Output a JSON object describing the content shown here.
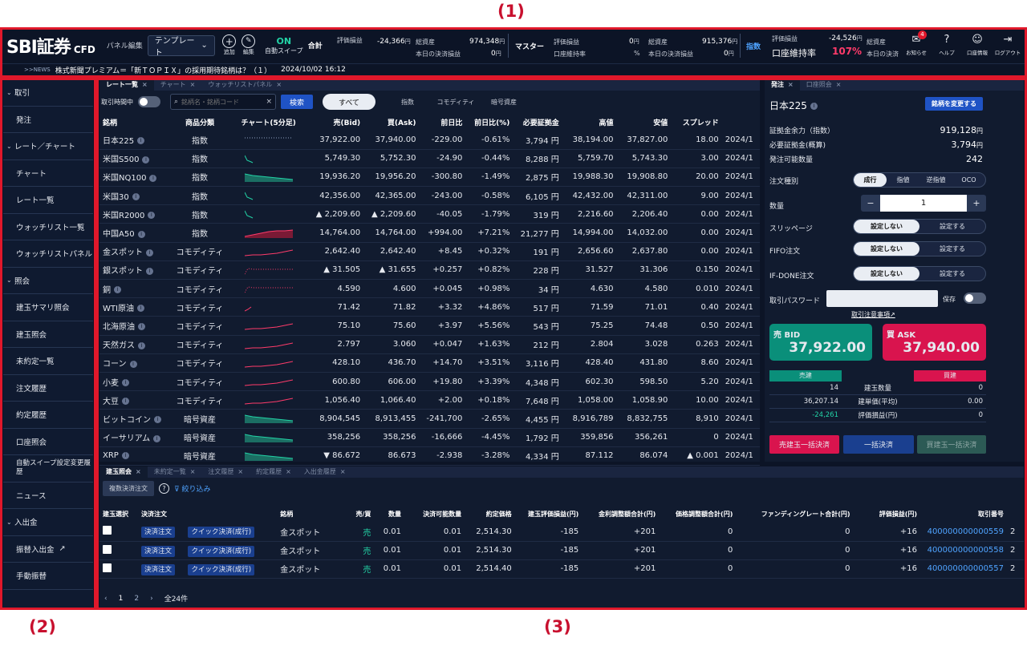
{
  "annotations": [
    "(1)",
    "(2)",
    "(3)"
  ],
  "header": {
    "logo": "SBI証券",
    "logo_sub": "CFD",
    "panel_edit_label": "パネル編集",
    "template_label": "テンプレート",
    "add_label": "追加",
    "edit_label": "編集",
    "auto_sweep_status": "ON",
    "auto_sweep_label": "自動スイープ",
    "total_label": "合計",
    "master_label": "マスター",
    "index_label": "指数",
    "total": {
      "eval_label": "評価損益",
      "eval_value": "-24,366",
      "yen": "円",
      "assets_label": "総資産",
      "assets_value": "974,348",
      "settle_label": "本日の決済損益",
      "settle_value": "0"
    },
    "master": {
      "eval_label": "評価損益",
      "eval_value": "0",
      "yen": "円",
      "rate_label": "口座維持率",
      "rate_value": "%",
      "assets_label": "総資産",
      "assets_value": "915,376",
      "settle_label": "本日の決済損益",
      "settle_value": "0"
    },
    "index": {
      "eval_label": "評価損益",
      "eval_value": "-24,526",
      "yen": "円",
      "rate_label": "口座維持率",
      "rate_value": "107%",
      "assets_label": "総資産",
      "settle_label": "本日の決済"
    },
    "icons": [
      {
        "name": "mail-icon",
        "label": "お知らせ",
        "badge": "4"
      },
      {
        "name": "help-icon",
        "label": "ヘルプ"
      },
      {
        "name": "account-icon",
        "label": "口座情報"
      },
      {
        "name": "logout-icon",
        "label": "ログアウト"
      }
    ],
    "news_tag": ">>NEWS",
    "news_text": "株式新聞プレミアム＝「新ＴＯＰＩＸ」の採用期待銘柄は？（１）",
    "news_time": "2024/10/02 16:12"
  },
  "sidebar": [
    {
      "label": "取引",
      "cat": true
    },
    {
      "label": "発注"
    },
    {
      "label": "レート／チャート",
      "cat": true
    },
    {
      "label": "チャート"
    },
    {
      "label": "レート一覧"
    },
    {
      "label": "ウォッチリスト一覧"
    },
    {
      "label": "ウォッチリストパネル"
    },
    {
      "label": "照会",
      "cat": true
    },
    {
      "label": "建玉サマリ照会"
    },
    {
      "label": "建玉照会"
    },
    {
      "label": "未約定一覧"
    },
    {
      "label": "注文履歴"
    },
    {
      "label": "約定履歴"
    },
    {
      "label": "口座照会"
    },
    {
      "label": "自動スイープ設定変更履歴"
    },
    {
      "label": "ニュース"
    },
    {
      "label": "入出金",
      "cat": true
    },
    {
      "label": "振替入出金",
      "ext": "↗"
    },
    {
      "label": "手動振替"
    }
  ],
  "rate_panel": {
    "tabs": [
      "レート一覧",
      "チャート",
      "ウォッチリストパネル"
    ],
    "open_only_label": "取引時間中",
    "search_placeholder": "銘柄名・銘柄コード",
    "search_button": "検索",
    "filters": [
      "すべて",
      "指数",
      "コモディティ",
      "暗号資産"
    ],
    "columns": [
      "銘柄",
      "商品分類",
      "チャート(5分足)",
      "売(Bid)",
      "買(Ask)",
      "前日比",
      "前日比(%)",
      "必要証拠金",
      "高値",
      "安値",
      "スプレッド",
      ""
    ],
    "rows": [
      {
        "name": "日本225",
        "cat": "指数",
        "bid": "37,922.00",
        "ask": "37,940.00",
        "chg": "-229.00",
        "pct": "-0.61%",
        "margin": "3,794 円",
        "high": "38,194.00",
        "low": "37,827.00",
        "spread": "18.00",
        "date": "2024/1",
        "dir": "dn",
        "spark": "dots"
      },
      {
        "name": "米国S500",
        "cat": "指数",
        "bid": "5,749.30",
        "ask": "5,752.30",
        "chg": "-24.90",
        "pct": "-0.44%",
        "margin": "8,288 円",
        "high": "5,759.70",
        "low": "5,743.30",
        "spread": "3.00",
        "date": "2024/1",
        "dir": "dn",
        "spark": "tiny"
      },
      {
        "name": "米国NQ100",
        "cat": "指数",
        "bid": "19,936.20",
        "ask": "19,956.20",
        "chg": "-300.80",
        "pct": "-1.49%",
        "margin": "2,875 円",
        "high": "19,988.30",
        "low": "19,908.80",
        "spread": "20.00",
        "date": "2024/1",
        "dir": "dn",
        "spark": "area"
      },
      {
        "name": "米国30",
        "cat": "指数",
        "bid": "42,356.00",
        "ask": "42,365.00",
        "chg": "-243.00",
        "pct": "-0.58%",
        "margin": "6,105 円",
        "high": "42,432.00",
        "low": "42,311.00",
        "spread": "9.00",
        "date": "2024/1",
        "dir": "dn",
        "spark": "tiny"
      },
      {
        "name": "米国R2000",
        "cat": "指数",
        "bid": "▲ 2,209.60",
        "ask": "▲ 2,209.60",
        "chg": "-40.05",
        "pct": "-1.79%",
        "margin": "319 円",
        "high": "2,216.60",
        "low": "2,206.40",
        "spread": "0.00",
        "date": "2024/1",
        "dir": "dn",
        "bidup": true,
        "spark": "tiny"
      },
      {
        "name": "中国A50",
        "cat": "指数",
        "bid": "14,764.00",
        "ask": "14,764.00",
        "chg": "+994.00",
        "pct": "+7.21%",
        "margin": "21,277 円",
        "high": "14,994.00",
        "low": "14,032.00",
        "spread": "0.00",
        "date": "2024/1",
        "dir": "up",
        "spark": "uparea"
      },
      {
        "name": "金スポット",
        "cat": "コモディティ",
        "bid": "2,642.40",
        "ask": "2,642.40",
        "chg": "+8.45",
        "pct": "+0.32%",
        "margin": "191 円",
        "high": "2,656.60",
        "low": "2,637.80",
        "spread": "0.00",
        "date": "2024/1",
        "dir": "up",
        "spark": "up"
      },
      {
        "name": "銀スポット",
        "cat": "コモディティ",
        "bid": "▲ 31.505",
        "ask": "▲ 31.655",
        "chg": "+0.257",
        "pct": "+0.82%",
        "margin": "228 円",
        "high": "31.527",
        "low": "31.306",
        "spread": "0.150",
        "date": "2024/1",
        "dir": "up",
        "bidup": true,
        "spark": "updots"
      },
      {
        "name": "銅",
        "cat": "コモディティ",
        "bid": "4.590",
        "ask": "4.600",
        "chg": "+0.045",
        "pct": "+0.98%",
        "margin": "34 円",
        "high": "4.630",
        "low": "4.580",
        "spread": "0.010",
        "date": "2024/1",
        "dir": "up",
        "spark": "updots"
      },
      {
        "name": "WTI原油",
        "cat": "コモディティ",
        "bid": "71.42",
        "ask": "71.82",
        "chg": "+3.32",
        "pct": "+4.86%",
        "margin": "517 円",
        "high": "71.59",
        "low": "71.01",
        "spread": "0.40",
        "date": "2024/1",
        "dir": "up",
        "spark": "uptiny"
      },
      {
        "name": "北海原油",
        "cat": "コモディティ",
        "bid": "75.10",
        "ask": "75.60",
        "chg": "+3.97",
        "pct": "+5.56%",
        "margin": "543 円",
        "high": "75.25",
        "low": "74.48",
        "spread": "0.50",
        "date": "2024/1",
        "dir": "up",
        "spark": "up"
      },
      {
        "name": "天然ガス",
        "cat": "コモディティ",
        "bid": "2.797",
        "ask": "3.060",
        "chg": "+0.047",
        "pct": "+1.63%",
        "margin": "212 円",
        "high": "2.804",
        "low": "3.028",
        "spread": "0.263",
        "date": "2024/1",
        "dir": "up",
        "spark": "up"
      },
      {
        "name": "コーン",
        "cat": "コモディティ",
        "bid": "428.10",
        "ask": "436.70",
        "chg": "+14.70",
        "pct": "+3.51%",
        "margin": "3,116 円",
        "high": "428.40",
        "low": "431.80",
        "spread": "8.60",
        "date": "2024/1",
        "dir": "up",
        "spark": "up"
      },
      {
        "name": "小麦",
        "cat": "コモディティ",
        "bid": "600.80",
        "ask": "606.00",
        "chg": "+19.80",
        "pct": "+3.39%",
        "margin": "4,348 円",
        "high": "602.30",
        "low": "598.50",
        "spread": "5.20",
        "date": "2024/1",
        "dir": "up",
        "spark": "up"
      },
      {
        "name": "大豆",
        "cat": "コモディティ",
        "bid": "1,056.40",
        "ask": "1,066.40",
        "chg": "+2.00",
        "pct": "+0.18%",
        "margin": "7,648 円",
        "high": "1,058.00",
        "low": "1,058.90",
        "spread": "10.00",
        "date": "2024/1",
        "dir": "up",
        "spark": "up"
      },
      {
        "name": "ビットコイン",
        "cat": "暗号資産",
        "bid": "8,904,545",
        "ask": "8,913,455",
        "chg": "-241,700",
        "pct": "-2.65%",
        "margin": "4,455 円",
        "high": "8,916,789",
        "low": "8,832,755",
        "spread": "8,910",
        "date": "2024/1",
        "dir": "dn",
        "spark": "area"
      },
      {
        "name": "イーサリアム",
        "cat": "暗号資産",
        "bid": "358,256",
        "ask": "358,256",
        "chg": "-16,666",
        "pct": "-4.45%",
        "margin": "1,792 円",
        "high": "359,856",
        "low": "356,261",
        "spread": "0",
        "date": "2024/1",
        "dir": "dn",
        "spark": "area"
      },
      {
        "name": "XRP",
        "cat": "暗号資産",
        "bid": "▼ 86.672",
        "ask": "86.673",
        "chg": "-2.938",
        "pct": "-3.28%",
        "margin": "4,334 円",
        "high": "87.112",
        "low": "86.074",
        "spread": "▲ 0.001",
        "date": "2024/1",
        "dir": "dn",
        "biddn": true,
        "spark": "area"
      }
    ]
  },
  "order_panel": {
    "tabs": [
      "発注",
      "口座照会"
    ],
    "symbol": "日本225",
    "change_button": "銘柄を変更する",
    "rows": [
      {
        "label": "証拠金余力（指数）",
        "value": "919,128",
        "unit": "円"
      },
      {
        "label": "必要証拠金(概算)",
        "value": "3,794",
        "unit": "円"
      },
      {
        "label": "発注可能数量",
        "value": "242",
        "unit": ""
      }
    ],
    "order_type_label": "注文種別",
    "order_types": [
      "成行",
      "指値",
      "逆指値",
      "OCO"
    ],
    "qty_label": "数量",
    "qty_value": "1",
    "minus": "−",
    "plus": "+",
    "slippage_label": "スリッページ",
    "fifo_label": "FIFO注文",
    "ifdone_label": "IF-DONE注文",
    "opt_off": "設定しない",
    "opt_on": "設定する",
    "password_label": "取引パスワード",
    "save_label": "保存",
    "notice_link": "取引注意事項",
    "sell_label": "売 BID",
    "sell_price": "37,922.00",
    "buy_label": "買 ASK",
    "buy_price": "37,940.00",
    "pos_sell_head": "売建",
    "pos_buy_head": "買建",
    "pos_rows": [
      {
        "sell": "14",
        "label": "建玉数量",
        "buy": "0"
      },
      {
        "sell": "36,207.14",
        "label": "建単価(平均)",
        "buy": "0.00"
      },
      {
        "sell": "-24,261",
        "label": "評価損益(円)",
        "buy": "0"
      }
    ],
    "btn_sell_close": "売建玉一括決済",
    "btn_close_all": "一括決済",
    "btn_buy_close": "買建玉一括決済"
  },
  "position_panel": {
    "tabs": [
      "建玉照会",
      "未約定一覧",
      "注文履歴",
      "約定履歴",
      "入出金履歴"
    ],
    "multi_close": "複数決済注文",
    "filter_label": "絞り込み",
    "columns": [
      "建玉選択",
      "決済注文",
      "",
      "銘柄",
      "売/買",
      "数量",
      "決済可能数量",
      "約定価格",
      "建玉評価損益(円)",
      "金利調整額合計(円)",
      "価格調整額合計(円)",
      "ファンディングレート合計(円)",
      "評価損益(円)",
      "取引番号",
      ""
    ],
    "close_btn": "決済注文",
    "quick_btn": "クイック決済(成行)",
    "rows": [
      {
        "name": "金スポット",
        "side": "売",
        "qty": "0.01",
        "avail": "0.01",
        "price": "2,514.30",
        "eval": "-185",
        "interest": "+201",
        "priceadj": "0",
        "funding": "0",
        "pl": "+16",
        "id": "400000000000559",
        "tail": "2"
      },
      {
        "name": "金スポット",
        "side": "売",
        "qty": "0.01",
        "avail": "0.01",
        "price": "2,514.30",
        "eval": "-185",
        "interest": "+201",
        "priceadj": "0",
        "funding": "0",
        "pl": "+16",
        "id": "400000000000558",
        "tail": "2"
      },
      {
        "name": "金スポット",
        "side": "売",
        "qty": "0.01",
        "avail": "0.01",
        "price": "2,514.40",
        "eval": "-185",
        "interest": "+201",
        "priceadj": "0",
        "funding": "0",
        "pl": "+16",
        "id": "400000000000557",
        "tail": "2"
      }
    ],
    "pager": [
      "‹",
      "1",
      "2",
      "›"
    ],
    "total": "全24件"
  },
  "colors": {
    "bg": "#0c1426",
    "panel": "#111b2f",
    "up": "#ff3b6a",
    "down": "#22d3a6",
    "sell": "#0a8f7a",
    "buy": "#d9144e",
    "annot": "#c8102e"
  }
}
